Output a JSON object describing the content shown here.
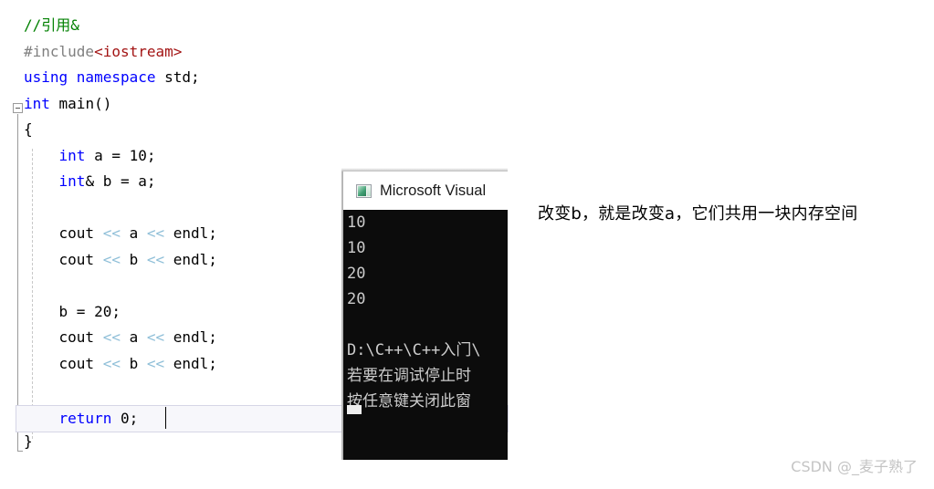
{
  "editor": {
    "name": "visual-studio-code-editor",
    "outlining_marker": "collapse-minus",
    "lines": [
      [
        {
          "t": "//引用&",
          "c": "cmt"
        }
      ],
      [
        {
          "t": "#include",
          "c": "pp"
        },
        {
          "t": "<iostream>",
          "c": "inc"
        }
      ],
      [
        {
          "t": "using namespace ",
          "c": "k"
        },
        {
          "t": "std;",
          "c": "pl"
        }
      ],
      [
        {
          "t": "int",
          "c": "k"
        },
        {
          "t": " main()",
          "c": "pl"
        }
      ],
      [
        {
          "t": "{",
          "c": "pl"
        }
      ],
      [
        {
          "t": "    ",
          "c": "pl"
        },
        {
          "t": "int",
          "c": "k"
        },
        {
          "t": " a = 10;",
          "c": "pl"
        }
      ],
      [
        {
          "t": "    ",
          "c": "pl"
        },
        {
          "t": "int",
          "c": "k"
        },
        {
          "t": "& b = a;",
          "c": "pl"
        }
      ],
      [
        {
          "t": "",
          "c": "pl"
        }
      ],
      [
        {
          "t": "    cout ",
          "c": "pl"
        },
        {
          "t": "<<",
          "c": "op"
        },
        {
          "t": " a ",
          "c": "pl"
        },
        {
          "t": "<<",
          "c": "op"
        },
        {
          "t": " endl;",
          "c": "pl"
        }
      ],
      [
        {
          "t": "    cout ",
          "c": "pl"
        },
        {
          "t": "<<",
          "c": "op"
        },
        {
          "t": " b ",
          "c": "pl"
        },
        {
          "t": "<<",
          "c": "op"
        },
        {
          "t": " endl;",
          "c": "pl"
        }
      ],
      [
        {
          "t": "",
          "c": "pl"
        }
      ],
      [
        {
          "t": "    b = 20;",
          "c": "pl"
        }
      ],
      [
        {
          "t": "    cout ",
          "c": "pl"
        },
        {
          "t": "<<",
          "c": "op"
        },
        {
          "t": " a ",
          "c": "pl"
        },
        {
          "t": "<<",
          "c": "op"
        },
        {
          "t": " endl;",
          "c": "pl"
        }
      ],
      [
        {
          "t": "    cout ",
          "c": "pl"
        },
        {
          "t": "<<",
          "c": "op"
        },
        {
          "t": " b ",
          "c": "pl"
        },
        {
          "t": "<<",
          "c": "op"
        },
        {
          "t": " endl;",
          "c": "pl"
        }
      ],
      [
        {
          "t": "",
          "c": "pl"
        }
      ],
      [
        {
          "t": "",
          "c": "pl"
        }
      ],
      [
        {
          "t": "}",
          "c": "pl"
        }
      ]
    ],
    "current_line": {
      "segments": [
        {
          "t": "    ",
          "c": "pl"
        },
        {
          "t": "return",
          "c": "k"
        },
        {
          "t": " 0;",
          "c": "pl"
        }
      ],
      "caret_visible": true
    },
    "colors": {
      "keyword": "#0000ff",
      "comment": "#008000",
      "preprocessor": "#808080",
      "include_header": "#a31515",
      "stream_operator": "#8fbfd8",
      "plain_text": "#000000",
      "current_line_bg": "#f7f7fb",
      "current_line_border": "#d6d6e6",
      "indent_guide": "#c8c8c8"
    }
  },
  "console": {
    "name": "microsoft-visual-studio-debug-console",
    "title": "Microsoft Visual",
    "icon": "console-window-icon",
    "output_lines": [
      "10",
      "10",
      "20",
      "20",
      "",
      "D:\\C++\\C++入门\\",
      "若要在调试停止时",
      "按任意键关闭此窗"
    ],
    "caret": "block-cursor",
    "colors": {
      "background": "#0c0c0c",
      "text": "#cccccc",
      "titlebar_background": "#ffffff",
      "titlebar_text": "#1a1a1a"
    }
  },
  "annotation": {
    "name": "explanation-note",
    "text": "改变b，就是改变a，它们共用一块内存空间"
  },
  "watermark": {
    "name": "csdn-watermark",
    "text": "CSDN @_麦子熟了",
    "color": "#c4c4c4"
  }
}
